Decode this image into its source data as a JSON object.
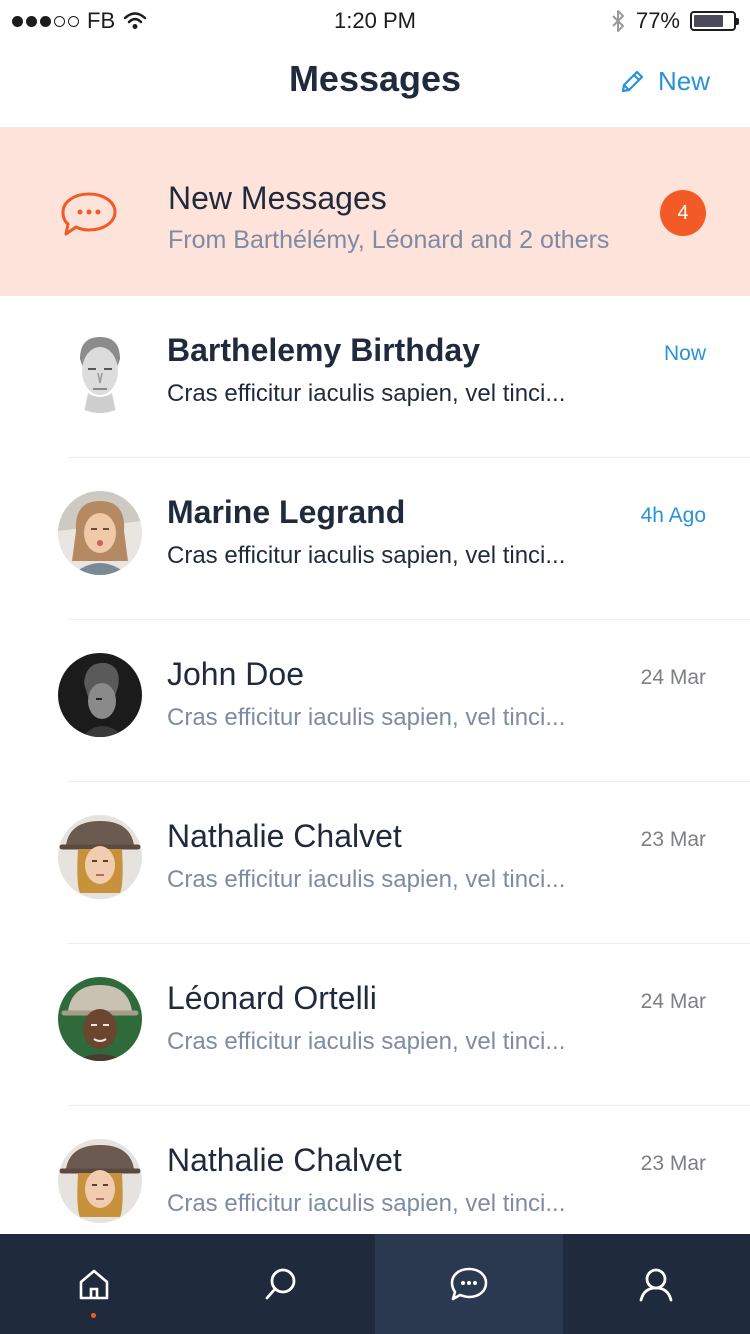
{
  "status_bar": {
    "carrier": "FB",
    "time": "1:20 PM",
    "battery": "77%",
    "battery_level": 0.77
  },
  "header": {
    "title": "Messages",
    "new_label": "New"
  },
  "banner": {
    "title": "New Messages",
    "subtitle": "From Barthélémy, Léonard and 2 others",
    "badge_count": "4"
  },
  "conversations": [
    {
      "name": "Barthelemy Birthday",
      "preview": "Cras efficitur iaculis sapien, vel tinci...",
      "time": "Now",
      "unread": true
    },
    {
      "name": "Marine Legrand",
      "preview": "Cras efficitur iaculis sapien, vel tinci...",
      "time": "4h Ago",
      "unread": true
    },
    {
      "name": "John Doe",
      "preview": "Cras efficitur iaculis sapien, vel tinci...",
      "time": "24 Mar",
      "unread": false
    },
    {
      "name": "Nathalie Chalvet",
      "preview": "Cras efficitur iaculis sapien, vel tinci...",
      "time": "23 Mar",
      "unread": false
    },
    {
      "name": "Léonard Ortelli",
      "preview": "Cras efficitur iaculis sapien, vel tinci...",
      "time": "24 Mar",
      "unread": false
    },
    {
      "name": "Nathalie Chalvet",
      "preview": "Cras efficitur iaculis sapien, vel tinci...",
      "time": "23 Mar",
      "unread": false
    }
  ],
  "tabbar": {
    "tabs": [
      {
        "icon": "home-icon",
        "active": false,
        "indicator": true
      },
      {
        "icon": "search-icon",
        "active": false,
        "indicator": false
      },
      {
        "icon": "chat-icon",
        "active": true,
        "indicator": false
      },
      {
        "icon": "profile-icon",
        "active": false,
        "indicator": false
      }
    ]
  },
  "colors": {
    "accent": "#f25a26",
    "link": "#2a92d6",
    "banner_bg": "#fde3d9",
    "tabbar_bg": "#1f2b3d",
    "text_dark": "#1f2b3d",
    "text_muted": "#7d8ba6"
  }
}
